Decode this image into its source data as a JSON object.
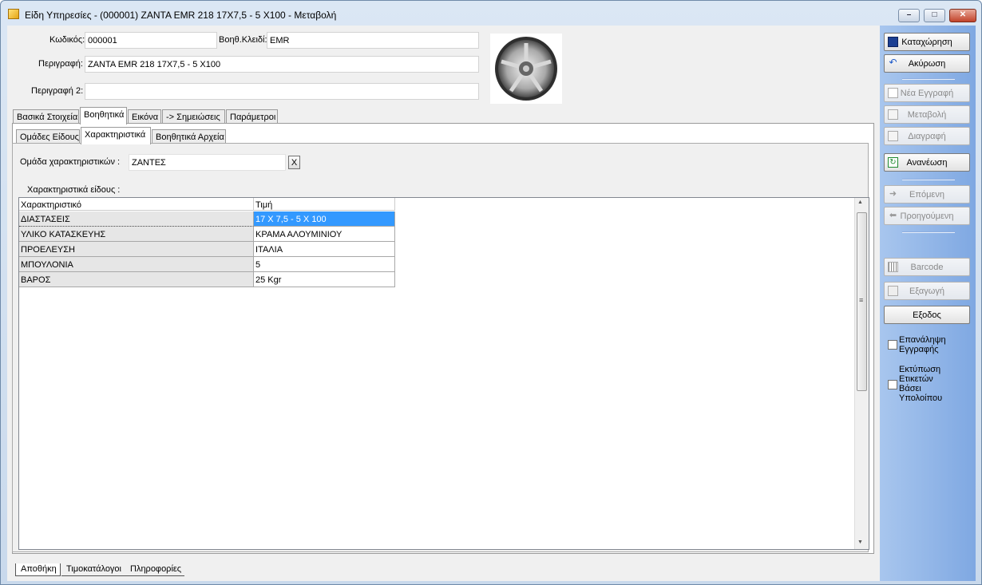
{
  "window": {
    "title": "Είδη Υπηρεσίες - (000001) ΖΑΝΤΑ EMR 218 17X7,5 - 5 X100  -  Μεταβολή",
    "min_label": "–",
    "max_label": "□",
    "close_label": "✕"
  },
  "form": {
    "code_label": "Κωδικός:",
    "code_value": "000001",
    "aux_key_label": "Βοηθ.Κλειδί:",
    "aux_key_value": "EMR",
    "desc_label": "Περιγραφή:",
    "desc_value": "ΖΑΝΤΑ EMR 218 17X7,5 - 5 X100",
    "desc2_label": "Περιγραφή 2:",
    "desc2_value": ""
  },
  "tabs": [
    "Βασικά Στοιχεία",
    "Βοηθητικά",
    "Εικόνα",
    "-> Σημειώσεις",
    "Παράμετροι"
  ],
  "subtabs": [
    "Ομάδες Είδους",
    "Χαρακτηριστικά",
    "Βοηθητικά Αρχεία"
  ],
  "group": {
    "label": "Ομάδα χαρακτηριστικών :",
    "value": "ΖΑΝΤΕΣ",
    "clear_label": "X"
  },
  "grid": {
    "title": "Χαρακτηριστικά είδους :",
    "columns": [
      "Χαρακτηριστικό",
      "Τιμή"
    ],
    "rows": [
      {
        "name": "ΔΙΑΣΤΑΣΕΙΣ",
        "value": "17 X 7,5 - 5 X 100",
        "selected": true
      },
      {
        "name": "ΥΛΙΚΟ ΚΑΤΑΣΚΕΥΗΣ",
        "value": "ΚΡΑΜΑ ΑΛΟΥΜΙΝΙΟΥ",
        "selected": false
      },
      {
        "name": "ΠΡΟΕΛΕΥΣΗ",
        "value": "ΙΤΑΛΙΑ",
        "selected": false
      },
      {
        "name": "ΜΠΟΥΛΟΝΙΑ",
        "value": "5",
        "selected": false
      },
      {
        "name": "ΒΑΡΟΣ",
        "value": "25 Kgr",
        "selected": false
      }
    ],
    "scroll_up": "▲",
    "scroll_down": "▼",
    "thumb_grip": "≡"
  },
  "bottom_tabs": [
    "Αποθήκη",
    "Τιμοκατάλογοι",
    "Πληροφορίες"
  ],
  "buttons": {
    "save": "Καταχώρηση",
    "cancel": "Ακύρωση",
    "new": "Νέα Εγγραφή",
    "edit": "Μεταβολή",
    "delete": "Διαγραφή",
    "refresh": "Ανανέωση",
    "next": "Επόμενη",
    "prev": "Προηγούμενη",
    "barcode": "Barcode",
    "export": "Εξαγωγή",
    "exit": "Εξοδος"
  },
  "checks": {
    "repeat": "Επανάληψη Εγγραφής",
    "print_labels": "Εκτύπωση Ετικετών Βάσει Υπολοίπου"
  },
  "colors": {
    "selection": "#3399ff",
    "right_panel": "#8eb3e6"
  }
}
